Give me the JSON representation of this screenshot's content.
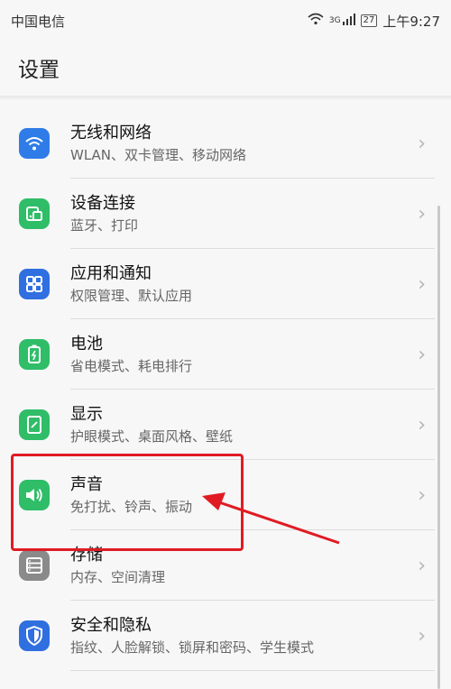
{
  "status": {
    "carrier": "中国电信",
    "network": "3G",
    "battery": "27",
    "time": "上午9:27"
  },
  "page_title": "设置",
  "items": [
    {
      "label": "无线和网络",
      "sub": "WLAN、双卡管理、移动网络",
      "icon": "wifi-icon",
      "color": "#2f7ce8"
    },
    {
      "label": "设备连接",
      "sub": "蓝牙、打印",
      "icon": "device-connect-icon",
      "color": "#2fbd68"
    },
    {
      "label": "应用和通知",
      "sub": "权限管理、默认应用",
      "icon": "apps-grid-icon",
      "color": "#2f6fe0"
    },
    {
      "label": "电池",
      "sub": "省电模式、耗电排行",
      "icon": "battery-icon",
      "color": "#2fbd68"
    },
    {
      "label": "显示",
      "sub": "护眼模式、桌面风格、壁纸",
      "icon": "display-icon",
      "color": "#2fbd68"
    },
    {
      "label": "声音",
      "sub": "免打扰、铃声、振动",
      "icon": "speaker-icon",
      "color": "#2fbd68"
    },
    {
      "label": "存储",
      "sub": "内存、空间清理",
      "icon": "storage-icon",
      "color": "#8a8a8a"
    },
    {
      "label": "安全和隐私",
      "sub": "指纹、人脸解锁、锁屏和密码、学生模式",
      "icon": "shield-icon",
      "color": "#2f6fe0"
    }
  ],
  "annotation_color": "#e01b23"
}
